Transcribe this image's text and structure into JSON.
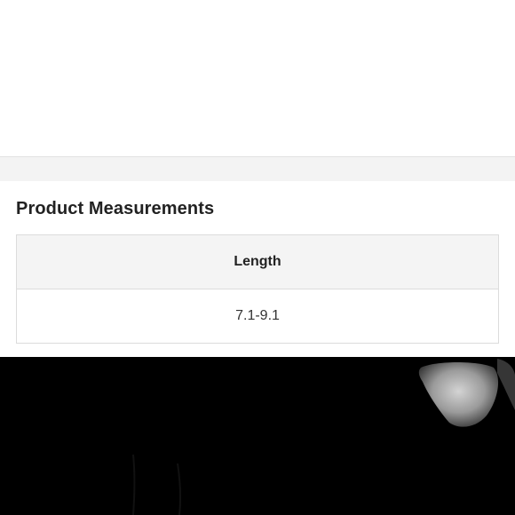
{
  "measurements": {
    "title": "Product Measurements",
    "column_header": "Length",
    "value": "7.1-9.1"
  }
}
